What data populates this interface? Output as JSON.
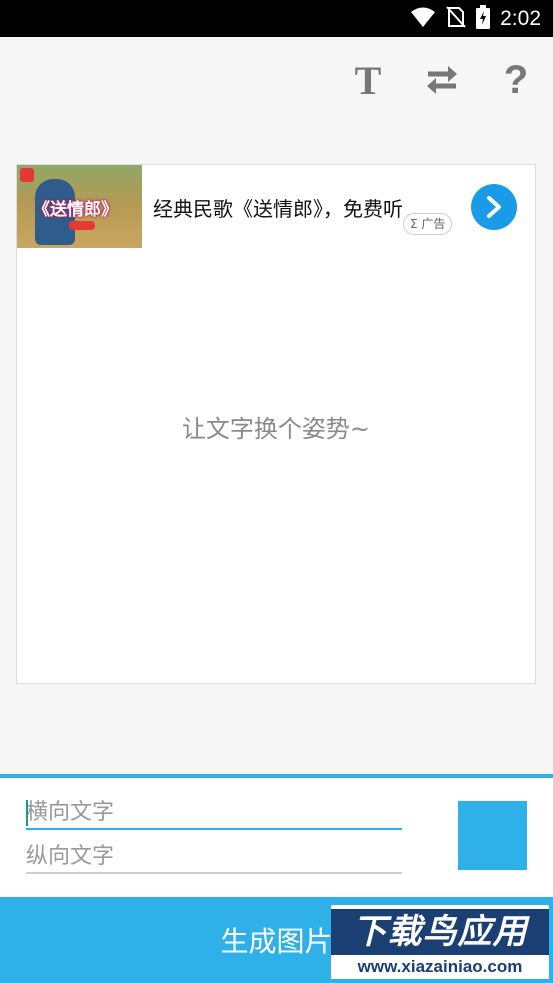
{
  "status_bar": {
    "time": "2:02",
    "icons": [
      "wifi-icon",
      "no-sim-icon",
      "battery-charging-icon"
    ]
  },
  "toolbar": {
    "icons": [
      "text-format-icon",
      "swap-icon",
      "help-icon"
    ],
    "t_glyph": "T",
    "help_glyph": "?"
  },
  "ad": {
    "thumbnail_text": "《送情郎》",
    "title": "经典民歌《送情郎》，免费听",
    "tag": "Σ 广告"
  },
  "preview": {
    "text": "让文字换个姿势~"
  },
  "inputs": {
    "horizontal_placeholder": "横向文字",
    "vertical_placeholder": "纵向文字"
  },
  "color_picker": {
    "color": "#2fb0e8"
  },
  "generate": {
    "label": "生成图片"
  },
  "watermark": {
    "main": "下载鸟应用",
    "sub": "www.xiazainiao.com"
  },
  "colors": {
    "accent": "#2fb0e8",
    "ad_arrow": "#1a9be8",
    "status_bar": "#000000"
  }
}
